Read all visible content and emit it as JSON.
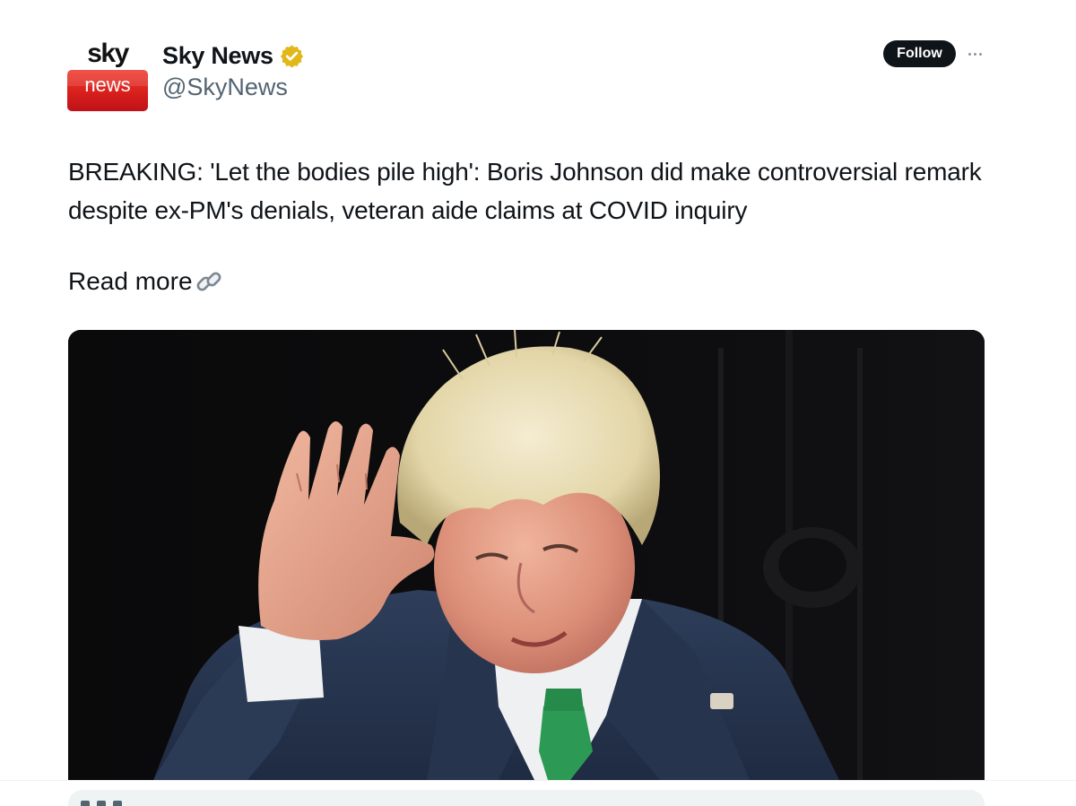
{
  "author": {
    "avatar_logo_text_top": "sky",
    "avatar_logo_text_bottom": "news",
    "display_name": "Sky News",
    "handle": "@SkyNews",
    "verified_badge_color": "#e2b719"
  },
  "actions": {
    "follow_label": "Follow"
  },
  "tweet": {
    "text": "BREAKING: 'Let the bodies pile high': Boris Johnson did make controversial remark despite ex-PM's denials, veteran aide claims at COVID inquiry",
    "read_more": "Read more"
  },
  "icons": {
    "verified": "verified-badge-icon",
    "link": "link-chain-icon",
    "more": "more-horizontal-icon"
  },
  "colors": {
    "brand_red": "#d8201c",
    "text_primary": "#0f1419",
    "text_secondary": "#536471",
    "follow_bg": "#0f1419"
  }
}
